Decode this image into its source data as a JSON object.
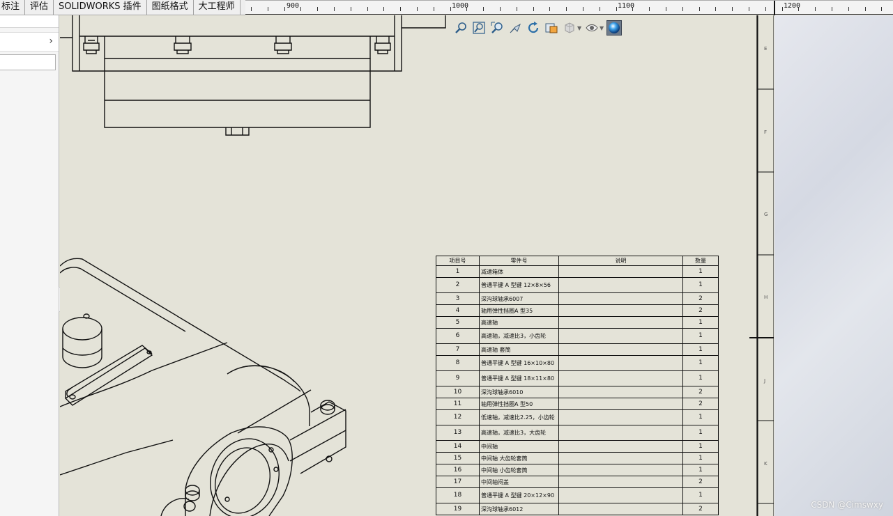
{
  "tabs": [
    {
      "label": "标注"
    },
    {
      "label": "评估"
    },
    {
      "label": "SOLIDWORKS 插件"
    },
    {
      "label": "图纸格式"
    },
    {
      "label": "大工程师"
    }
  ],
  "ruler": {
    "labels": [
      "900",
      "1000",
      "1100",
      "1200"
    ]
  },
  "zones": [
    "E",
    "F",
    "G",
    "H",
    "J",
    "K"
  ],
  "view_toolbar": {
    "icons": [
      "zoom-to-fit-icon",
      "zoom-to-area-icon",
      "zoom-in-out-icon",
      "pan-icon",
      "rotate-icon",
      "view-orientation-icon",
      "display-style-icon",
      "hide-show-icon",
      "appearance-icon"
    ]
  },
  "bom": {
    "headers": [
      "项目号",
      "零件号",
      "说明",
      "数量"
    ],
    "rows": [
      {
        "no": "1",
        "part": "减速箱体",
        "desc": "",
        "qty": "1"
      },
      {
        "no": "2",
        "part": "普通平键 A 型键 12×8×56",
        "desc": "",
        "qty": "1"
      },
      {
        "no": "3",
        "part": "深沟球轴承6007",
        "desc": "",
        "qty": "2"
      },
      {
        "no": "4",
        "part": "轴用弹性挡圈A 型35",
        "desc": "",
        "qty": "2"
      },
      {
        "no": "5",
        "part": "高速轴",
        "desc": "",
        "qty": "1"
      },
      {
        "no": "6",
        "part": "高速轴，减速比3，小齿轮",
        "desc": "",
        "qty": "1"
      },
      {
        "no": "7",
        "part": "高速轴 套筒",
        "desc": "",
        "qty": "1"
      },
      {
        "no": "8",
        "part": "普通平键 A 型键 16×10×80",
        "desc": "",
        "qty": "1"
      },
      {
        "no": "9",
        "part": "普通平键 A 型键 18×11×80",
        "desc": "",
        "qty": "1"
      },
      {
        "no": "10",
        "part": "深沟球轴承6010",
        "desc": "",
        "qty": "2"
      },
      {
        "no": "11",
        "part": "轴用弹性挡圈A 型50",
        "desc": "",
        "qty": "2"
      },
      {
        "no": "12",
        "part": "低速轴，减速比2.25，小齿轮",
        "desc": "",
        "qty": "1"
      },
      {
        "no": "13",
        "part": "高速轴，减速比3，大齿轮",
        "desc": "",
        "qty": "1"
      },
      {
        "no": "14",
        "part": "中间轴",
        "desc": "",
        "qty": "1"
      },
      {
        "no": "15",
        "part": "中间轴 大齿轮套筒",
        "desc": "",
        "qty": "1"
      },
      {
        "no": "16",
        "part": "中间轴 小齿轮套筒",
        "desc": "",
        "qty": "1"
      },
      {
        "no": "17",
        "part": "中间轴闷盖",
        "desc": "",
        "qty": "2"
      },
      {
        "no": "18",
        "part": "普通平键 A 型键 20×12×90",
        "desc": "",
        "qty": "1"
      },
      {
        "no": "19",
        "part": "深沟球轴承6012",
        "desc": "",
        "qty": "2"
      }
    ]
  },
  "watermark": "CSDN @Cimswxy",
  "colors": {
    "sheet": "#e4e3d8",
    "line": "#111111",
    "panel": "#f5f5f5"
  }
}
